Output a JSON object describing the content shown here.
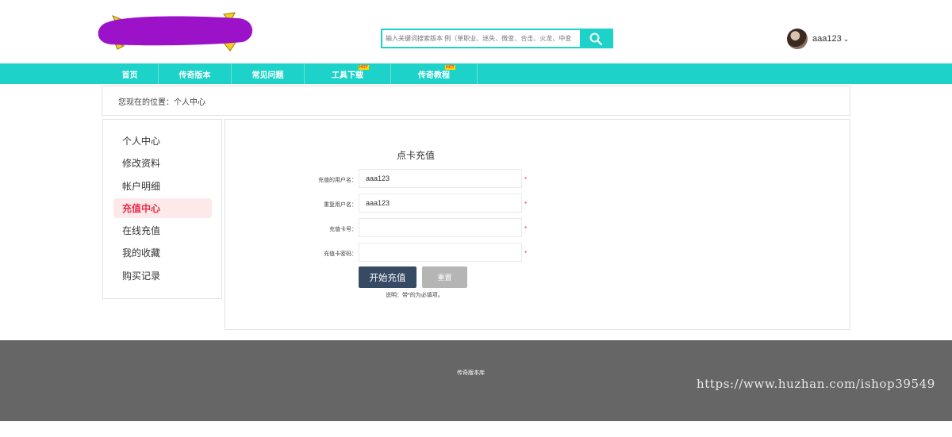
{
  "search": {
    "placeholder": "输入关键词搜索版本 例（单职业、迷失、微变、合击、火龙、中变"
  },
  "user": {
    "name": "aaa123"
  },
  "nav": [
    {
      "label": "首页",
      "hot": ""
    },
    {
      "label": "传奇版本",
      "hot": ""
    },
    {
      "label": "常见问题",
      "hot": ""
    },
    {
      "label": "工具下载",
      "hot": "HOT"
    },
    {
      "label": "传奇教程",
      "hot": "HOT"
    }
  ],
  "breadcrumb": "您现在的位置：个人中心",
  "sidebar": {
    "items": [
      {
        "label": "个人中心"
      },
      {
        "label": "修改资料"
      },
      {
        "label": "帐户明细"
      },
      {
        "label": "充值中心",
        "active": true
      },
      {
        "label": "在线充值"
      },
      {
        "label": "我的收藏"
      },
      {
        "label": "购买记录"
      }
    ]
  },
  "form": {
    "title": "点卡充值",
    "fields": [
      {
        "label": "充值的用户名：",
        "value": "aaa123"
      },
      {
        "label": "重复用户名：",
        "value": "aaa123"
      },
      {
        "label": "充值卡号：",
        "value": ""
      },
      {
        "label": "充值卡密码：",
        "value": ""
      }
    ],
    "required_mark": "*",
    "submit_label": "开始充值",
    "reset_label": "重置",
    "note": "说明：带*的为必填项。"
  },
  "footer": {
    "text": "传奇版本库"
  },
  "watermark": "https://www.huzhan.com/ishop39549",
  "colors": {
    "accent": "#1dd2c9",
    "active": "#ee2b48",
    "submit": "#364a63",
    "footer": "#666666"
  }
}
